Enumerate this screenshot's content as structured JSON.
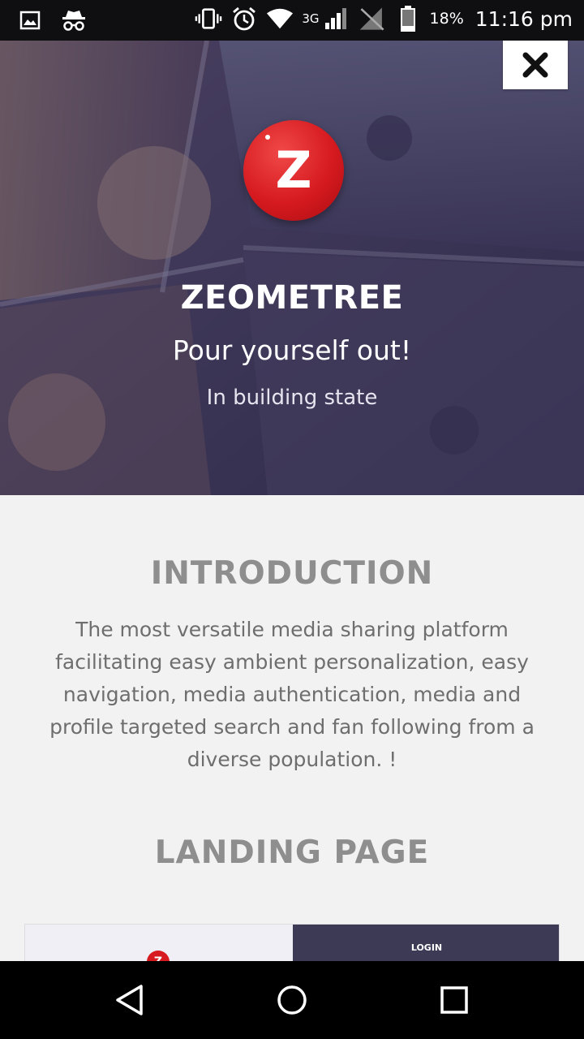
{
  "status_bar": {
    "network": "3G",
    "battery_percent": "18%",
    "time": "11:16 pm",
    "icons": [
      "image-icon",
      "incognito-icon",
      "vibrate-icon",
      "alarm-icon",
      "wifi-icon",
      "cellular-signal-icon",
      "no-sim-icon",
      "battery-icon"
    ]
  },
  "hero": {
    "brand_name": "ZEOMETREE",
    "tagline": "Pour yourself out!",
    "state": "In building state",
    "logo_letter": "Z",
    "close_icon": "close-icon"
  },
  "introduction": {
    "heading": "INTRODUCTION",
    "text": "The most versatile media sharing platform facilitating easy ambient personalization, easy navigation, media authentication, media and profile targeted search and fan following from a diverse population. !"
  },
  "landing": {
    "heading": "LANDING PAGE",
    "preview_logo_letter": "Z",
    "preview_login": "LOGIN"
  },
  "nav_bar": {
    "icons": [
      "back-icon",
      "home-icon",
      "recents-icon"
    ]
  },
  "colors": {
    "logo_red": "#d61a1f",
    "hero_tint": "#3e3a59",
    "heading_gray": "#8e8e8e",
    "body_text": "#6e6e6e",
    "page_bg": "#f2f2f2"
  }
}
